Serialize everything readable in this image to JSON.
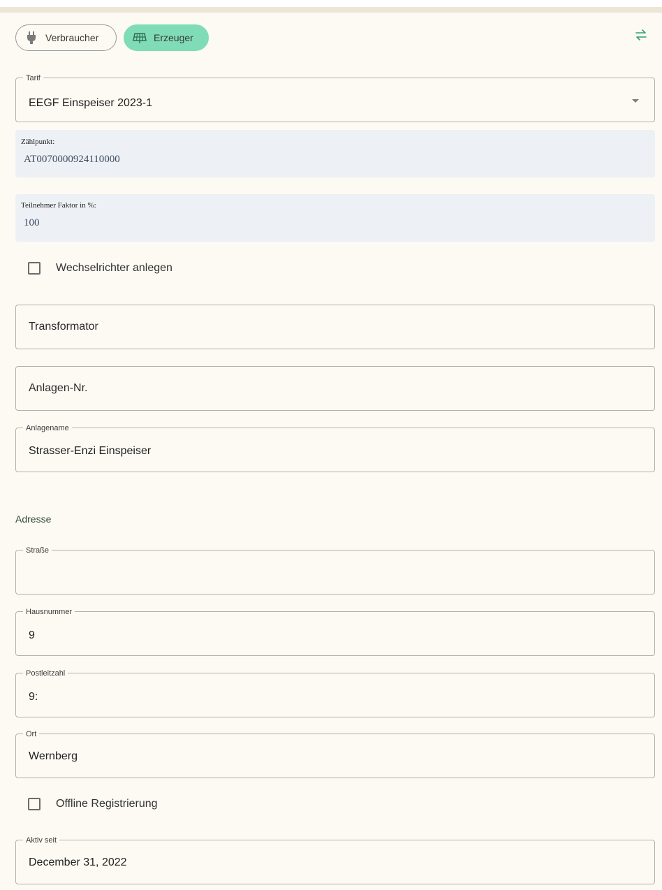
{
  "type_toggle": {
    "consumer_label": "Verbraucher",
    "consumer_icon": "plug-icon",
    "producer_label": "Erzeuger",
    "producer_icon": "solar-panel-icon",
    "producer_selected": true,
    "swap_icon": "swap-arrows-icon"
  },
  "tariff": {
    "label": "Tarif",
    "value": "EEGF Einspeiser 2023-1"
  },
  "meter_point": {
    "label": "Zählpunkt:",
    "value": "AT0070000924110000"
  },
  "participant_factor": {
    "label": "Teilnehmer Faktor in %:",
    "value": "100"
  },
  "inverter_checkbox": {
    "label": "Wechselrichter anlegen",
    "checked": false
  },
  "transformer": {
    "placeholder": "Transformator"
  },
  "plant_number": {
    "placeholder": "Anlagen-Nr."
  },
  "plant_name": {
    "label": "Anlagename",
    "value": "Strasser-Enzi Einspeiser"
  },
  "address": {
    "heading": "Adresse",
    "street": {
      "label": "Straße",
      "value": ""
    },
    "house_number": {
      "label": "Hausnummer",
      "value": "9"
    },
    "postal_code": {
      "label": "Postleitzahl",
      "value": "9:"
    },
    "city": {
      "label": "Ort",
      "value": "Wernberg"
    }
  },
  "offline_checkbox": {
    "label": "Offline Registrierung",
    "checked": false
  },
  "active_since": {
    "label": "Aktiv seit",
    "value": "December 31, 2022"
  },
  "colors": {
    "background": "#fdfaf3",
    "chip_selected": "#7fdcb7",
    "readonly_box": "#edf0f5",
    "accent": "#2f9e76"
  }
}
